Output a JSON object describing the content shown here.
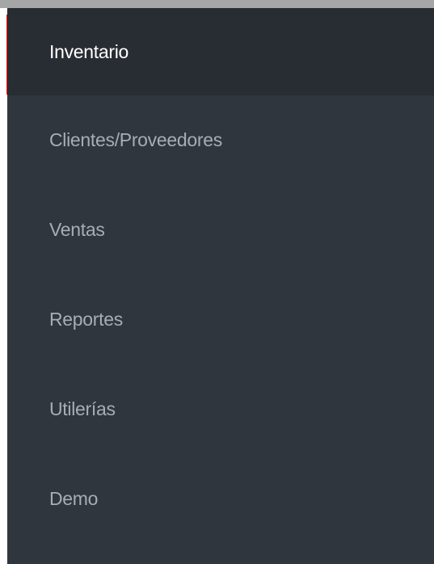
{
  "sidebar": {
    "items": [
      {
        "label": "Inventario",
        "active": true
      },
      {
        "label": "Clientes/Proveedores",
        "active": false
      },
      {
        "label": "Ventas",
        "active": false
      },
      {
        "label": "Reportes",
        "active": false
      },
      {
        "label": "Utilerías",
        "active": false
      },
      {
        "label": "Demo",
        "active": false
      }
    ]
  },
  "colors": {
    "sidebar_background": "#2f363d",
    "active_background": "#272d33",
    "active_text": "#ffffff",
    "inactive_text": "#a7adb3",
    "highlight_outline": "#e8141a"
  }
}
